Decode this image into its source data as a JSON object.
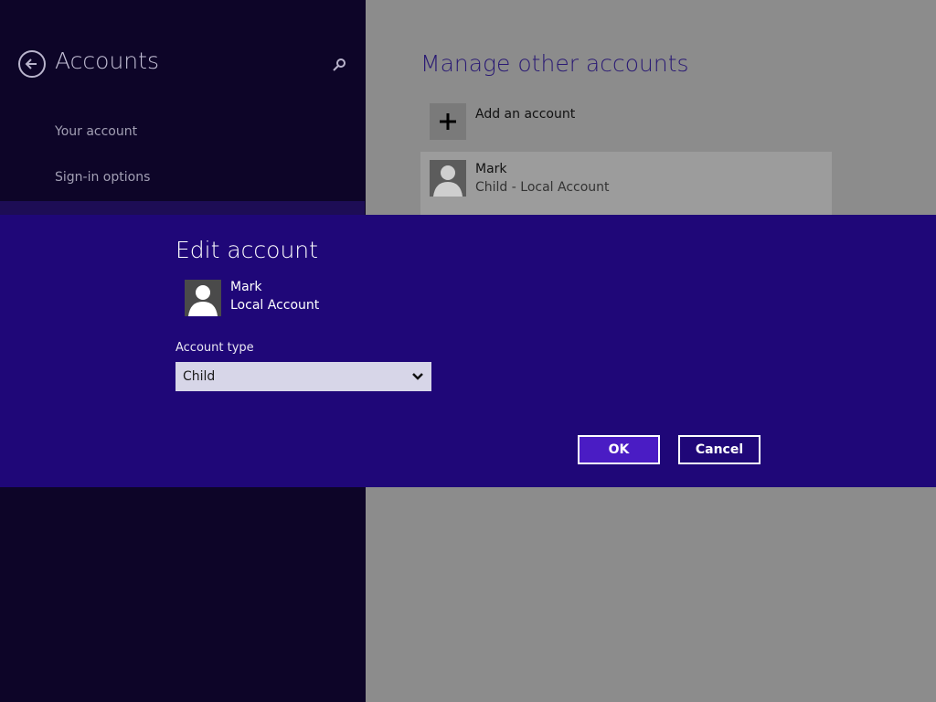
{
  "sidebar": {
    "title": "Accounts",
    "back_icon": "back-arrow-icon",
    "search_icon": "search-icon",
    "items": [
      {
        "label": "Your account"
      },
      {
        "label": "Sign-in options"
      }
    ]
  },
  "main": {
    "title": "Manage other accounts",
    "add_account_label": "Add an account",
    "accounts": [
      {
        "name": "Mark",
        "type": "Child - Local Account"
      }
    ]
  },
  "dialog": {
    "title": "Edit account",
    "user_name": "Mark",
    "user_type": "Local Account",
    "account_type_label": "Account type",
    "account_type_value": "Child",
    "ok_label": "OK",
    "cancel_label": "Cancel"
  },
  "colors": {
    "sidebar_bg": "#0d0528",
    "dialog_bg": "#1f0778",
    "ok_bg": "#4a1cc4",
    "content_bg_dimmed": "#8c8c8c"
  }
}
